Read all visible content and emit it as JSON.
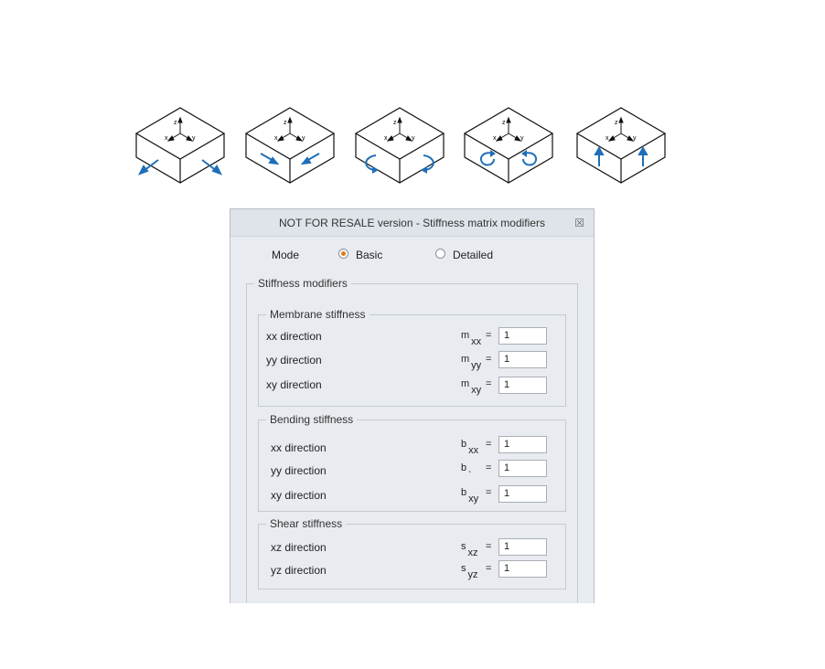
{
  "dialog": {
    "title": "NOT FOR RESALE version - Stiffness matrix modifiers",
    "close_glyph": "☒"
  },
  "cube_icons": [
    {
      "name": "membrane-xx",
      "axes": {
        "z": "z",
        "x": "x",
        "y": "y"
      }
    },
    {
      "name": "membrane-yy",
      "axes": {
        "z": "z",
        "x": "x",
        "y": "y"
      }
    },
    {
      "name": "bending-xx",
      "axes": {
        "z": "z",
        "x": "x",
        "y": "y"
      }
    },
    {
      "name": "bending-yy",
      "axes": {
        "z": "z",
        "x": "x",
        "y": "y"
      }
    },
    {
      "name": "shear",
      "axes": {
        "z": "z",
        "x": "x",
        "y": "y"
      }
    }
  ],
  "mode": {
    "label": "Mode",
    "options": [
      "Basic",
      "Detailed"
    ],
    "selected": "Basic"
  },
  "stiffness": {
    "title": "Stiffness modifiers",
    "membrane": {
      "title": "Membrane stiffness",
      "rows": [
        {
          "label": "xx direction",
          "sym": "m",
          "sub": "xx",
          "value": "1"
        },
        {
          "label": "yy direction",
          "sym": "m",
          "sub": "yy",
          "value": "1"
        },
        {
          "label": "xy direction",
          "sym": "m",
          "sub": "xy",
          "value": "1"
        }
      ]
    },
    "bending": {
      "title": "Bending stiffness",
      "rows": [
        {
          "label": "xx direction",
          "sym": "b",
          "sub": "xx",
          "value": "1"
        },
        {
          "label": "yy direction",
          "sym": "b",
          "sub": "ˎ",
          "value": "1"
        },
        {
          "label": "xy direction",
          "sym": "b",
          "sub": "xy",
          "value": "1"
        }
      ]
    },
    "shear": {
      "title": "Shear stiffness",
      "rows": [
        {
          "label": "xz direction",
          "sym": "s",
          "sub": "xz",
          "value": "1"
        },
        {
          "label": "yz direction",
          "sym": "s",
          "sub": "yz",
          "value": "1"
        }
      ]
    },
    "equals": "="
  },
  "colors": {
    "arrow": "#1f6fb8",
    "radio_selected": "#e07a1a"
  }
}
